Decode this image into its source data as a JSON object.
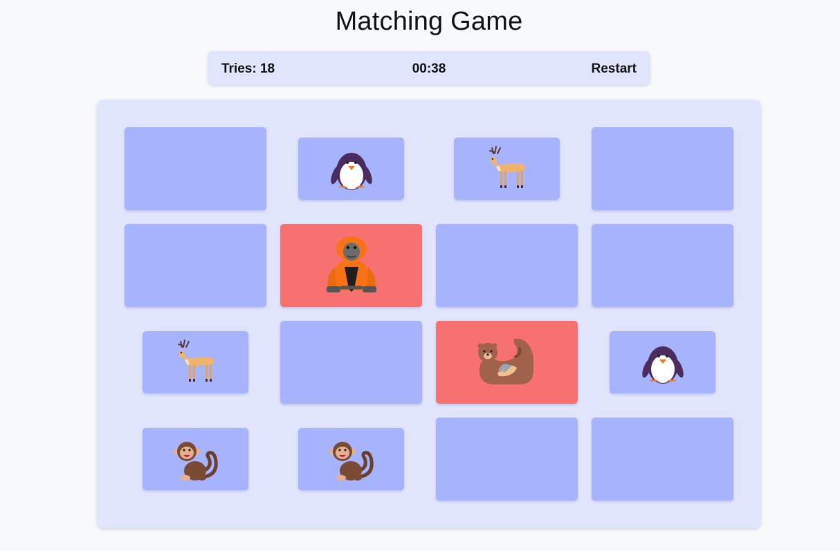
{
  "title": "Matching Game",
  "status": {
    "tries_text": "Tries: 18",
    "timer": "00:38",
    "restart_label": "Restart"
  },
  "colors": {
    "card_back": "#a5b4fc",
    "card_selected": "#f87171",
    "board": "#e0e5fd"
  },
  "cards": [
    {
      "row": 1,
      "col": 1,
      "state": "face-down",
      "animal": ""
    },
    {
      "row": 1,
      "col": 2,
      "state": "matched",
      "animal": "penguin"
    },
    {
      "row": 1,
      "col": 3,
      "state": "matched",
      "animal": "deer"
    },
    {
      "row": 1,
      "col": 4,
      "state": "face-down",
      "animal": ""
    },
    {
      "row": 2,
      "col": 1,
      "state": "face-down",
      "animal": ""
    },
    {
      "row": 2,
      "col": 2,
      "state": "flipped-mismatch",
      "animal": "orangutan"
    },
    {
      "row": 2,
      "col": 3,
      "state": "face-down",
      "animal": ""
    },
    {
      "row": 2,
      "col": 4,
      "state": "face-down",
      "animal": ""
    },
    {
      "row": 3,
      "col": 1,
      "state": "matched",
      "animal": "deer"
    },
    {
      "row": 3,
      "col": 2,
      "state": "face-down",
      "animal": ""
    },
    {
      "row": 3,
      "col": 3,
      "state": "flipped-mismatch",
      "animal": "otter"
    },
    {
      "row": 3,
      "col": 4,
      "state": "matched",
      "animal": "penguin"
    },
    {
      "row": 4,
      "col": 1,
      "state": "matched",
      "animal": "monkey"
    },
    {
      "row": 4,
      "col": 2,
      "state": "matched",
      "animal": "monkey"
    },
    {
      "row": 4,
      "col": 3,
      "state": "face-down",
      "animal": ""
    },
    {
      "row": 4,
      "col": 4,
      "state": "face-down",
      "animal": ""
    }
  ]
}
